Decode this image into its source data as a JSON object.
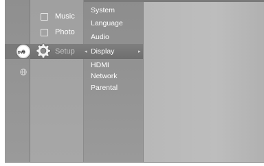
{
  "main_menu": {
    "music": "Music",
    "photo": "Photo",
    "setup": "Setup"
  },
  "left_icons": {
    "disc_label": "DVD"
  },
  "setup_submenu": {
    "items": [
      {
        "label": "System"
      },
      {
        "label": "Language"
      },
      {
        "label": "Audio"
      },
      {
        "label": "Display"
      },
      {
        "label": "HDMI"
      },
      {
        "label": "Network"
      },
      {
        "label": "Parental"
      }
    ],
    "selected": "Display"
  },
  "icons": [
    "music-icon",
    "photo-icon",
    "gear-icon",
    "dvd-disc-icon",
    "globe-icon",
    "left-arrow-icon",
    "right-arrow-icon"
  ],
  "colors": {
    "text": "#ffffff",
    "muted_text": "#c8c8c8",
    "highlight": "#727272"
  }
}
